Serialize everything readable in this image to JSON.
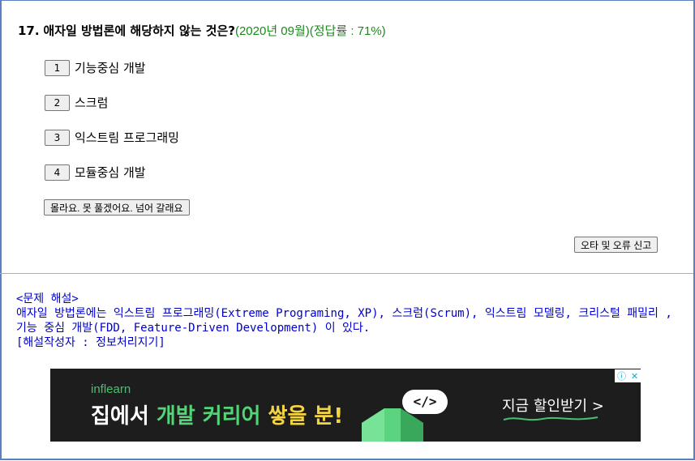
{
  "question": {
    "number": "17.",
    "text": "애자일 방법론에 해당하지 않는 것은?",
    "meta": "(2020년 09월)(정답률 : 71%)"
  },
  "options": [
    {
      "num": "1",
      "label": "기능중심 개발"
    },
    {
      "num": "2",
      "label": "스크럼"
    },
    {
      "num": "3",
      "label": "익스트림 프로그래밍"
    },
    {
      "num": "4",
      "label": "모듈중심 개발"
    }
  ],
  "skip_label": "몰라요. 못 풀겠어요. 넘어 갈래요",
  "report_label": "오타 및 오류 신고",
  "explanation": {
    "heading": "<문제 해설>",
    "body": "애자일 방법론에는 익스트림 프로그래밍(Extreme Programing, XP), 스크럼(Scrum), 익스트림 모델링, 크리스털 패밀리 , 기능 중심 개발(FDD, Feature-Driven Development) 이 있다.",
    "author": "[해설작성자 : 정보처리지기]"
  },
  "ad": {
    "logo": "inflearn",
    "headline_part1": "집에서 ",
    "headline_part2": "개발 커리어",
    "headline_part3": " 쌓을 분!",
    "code_symbol": "</>",
    "cta": "지금 할인받기 >",
    "info_icon": "ⓘ",
    "close_icon": "✕",
    "colors": {
      "brand": "#49c06e",
      "highlight": "#f5d442",
      "background": "#1d1d1d"
    }
  }
}
